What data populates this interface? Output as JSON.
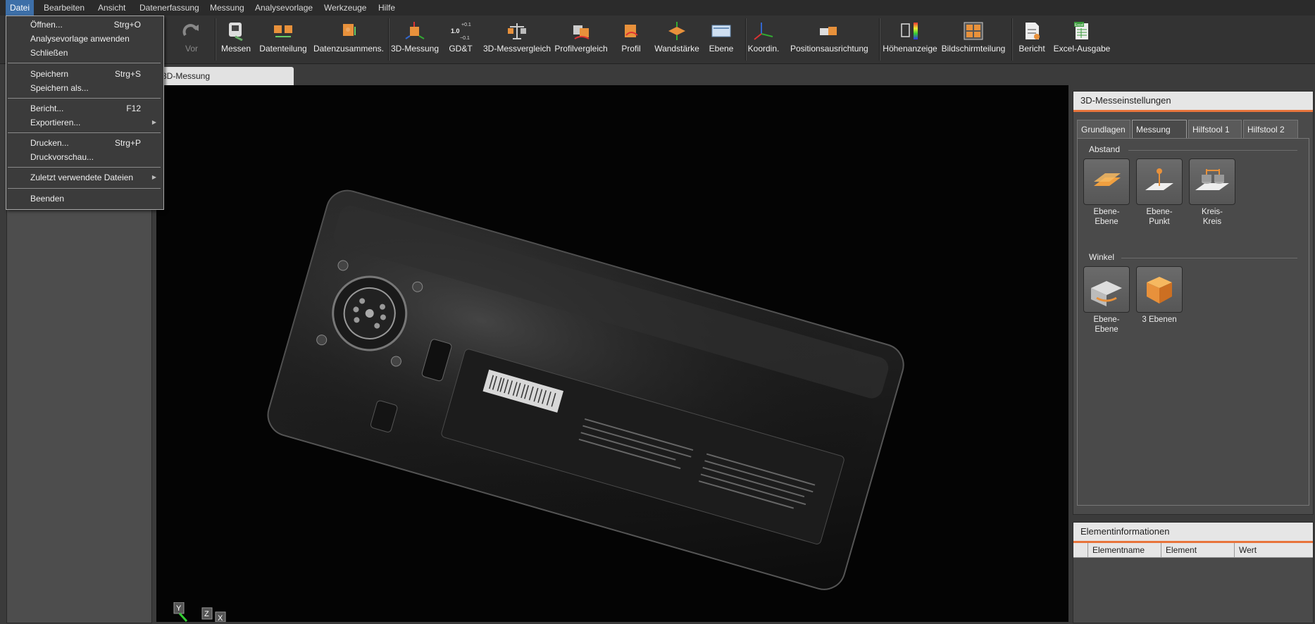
{
  "menubar": {
    "items": [
      "Datei",
      "Bearbeiten",
      "Ansicht",
      "Datenerfassung",
      "Messung",
      "Analysevorlage",
      "Werkzeuge",
      "Hilfe"
    ]
  },
  "toolbar": {
    "vor": "Vor",
    "messen": "Messen",
    "datenteilung": "Datenteilung",
    "datenzusammens": "Datenzusammens.",
    "messung3d": "3D-Messung",
    "gdt": "GD&T",
    "gdt_plus": "+0.1",
    "gdt_value": "1.0",
    "gdt_minus": "−0.1",
    "messvergleich": "3D-Messvergleich",
    "profilvergleich": "Profilvergleich",
    "profil": "Profil",
    "wandstaerke": "Wandstärke",
    "ebene": "Ebene",
    "koordin": "Koordin.",
    "positionsausrichtung": "Positionsausrichtung",
    "hoehenanzeige": "Höhenanzeige",
    "bildschirmteilung": "Bildschirmteilung",
    "bericht": "Bericht",
    "excel": "Excel-Ausgabe",
    "excel_badge": "Excel"
  },
  "doc_tab": "3D-Messung",
  "file_menu": {
    "items": [
      {
        "label": "Öffnen...",
        "shortcut": "Strg+O"
      },
      {
        "label": "Analysevorlage anwenden",
        "shortcut": ""
      },
      {
        "label": "Schließen",
        "shortcut": ""
      },
      {
        "label": "Speichern",
        "shortcut": "Strg+S"
      },
      {
        "label": "Speichern als...",
        "shortcut": ""
      },
      {
        "label": "Bericht...",
        "shortcut": "F12"
      },
      {
        "label": "Exportieren...",
        "shortcut": ""
      },
      {
        "label": "Drucken...",
        "shortcut": "Strg+P"
      },
      {
        "label": "Druckvorschau...",
        "shortcut": ""
      },
      {
        "label": "Zuletzt verwendete Dateien",
        "shortcut": ""
      },
      {
        "label": "Beenden",
        "shortcut": ""
      }
    ]
  },
  "settings_panel": {
    "title": "3D-Messeinstellungen",
    "tabs": [
      "Grundlagen",
      "Messung",
      "Hilfstool 1",
      "Hilfstool 2"
    ],
    "selected_tab": "Messung",
    "abstand": {
      "title": "Abstand",
      "tools": [
        {
          "line1": "Ebene-",
          "line2": "Ebene"
        },
        {
          "line1": "Ebene-",
          "line2": "Punkt"
        },
        {
          "line1": "Kreis-",
          "line2": "Kreis"
        }
      ]
    },
    "winkel": {
      "title": "Winkel",
      "tools": [
        {
          "line1": "Ebene-",
          "line2": "Ebene"
        },
        {
          "line1": "3 Ebenen",
          "line2": ""
        }
      ]
    }
  },
  "element_panel": {
    "title": "Elementinformationen",
    "columns": [
      "Elementname",
      "Element",
      "Wert"
    ]
  },
  "axes": {
    "x": "X",
    "y": "Y",
    "z": "Z"
  },
  "colors": {
    "accent": "#e8743b",
    "menu_highlight": "#3d6fa8"
  }
}
